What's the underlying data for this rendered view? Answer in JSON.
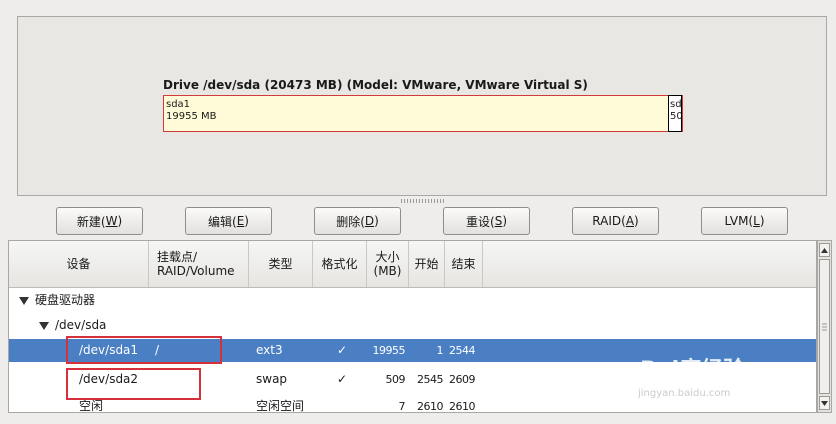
{
  "drive": {
    "title": "Drive /dev/sda (20473 MB) (Model: VMware, VMware Virtual S)",
    "partition_name": "sda1",
    "partition_size": "19955 MB",
    "small_segment_line1": "sd",
    "small_segment_line2": "50"
  },
  "toolbar": {
    "new_label": "新建(",
    "new_key": "W",
    "new_end": ")",
    "edit_label": "编辑(",
    "edit_key": "E",
    "edit_end": ")",
    "delete_label": "删除(",
    "delete_key": "D",
    "delete_end": ")",
    "reset_label": "重设(",
    "reset_key": "S",
    "reset_end": ")",
    "raid_label": "RAID(",
    "raid_key": "A",
    "raid_end": ")",
    "lvm_label": "LVM(",
    "lvm_key": "L",
    "lvm_end": ")"
  },
  "table": {
    "headers": {
      "device": "设备",
      "mount_line1": "挂载点/",
      "mount_line2": "RAID/Volume",
      "type": "类型",
      "format": "格式化",
      "size_line1": "大小",
      "size_line2": "(MB)",
      "start": "开始",
      "end": "结束"
    },
    "group": {
      "label": "硬盘驱动器"
    },
    "disk": {
      "label": "/dev/sda"
    },
    "rows": [
      {
        "device": "/dev/sda1",
        "mount": "/",
        "type": "ext3",
        "format": "✓",
        "size": "19955",
        "start": "1",
        "end": "2544"
      },
      {
        "device": "/dev/sda2",
        "mount": "",
        "type": "swap",
        "format": "✓",
        "size": "509",
        "start": "2545",
        "end": "2609"
      },
      {
        "device": "空闲",
        "mount": "",
        "type": "空闲空间",
        "format": "",
        "size": "7",
        "start": "2610",
        "end": "2610"
      }
    ]
  },
  "watermark": {
    "brand": "Bai度经验",
    "url": "jingyan.baidu.com"
  },
  "colors": {
    "selected_row": "#4a7fc4",
    "annotation": "#d4313a",
    "partition_fill": "#fffad7"
  }
}
